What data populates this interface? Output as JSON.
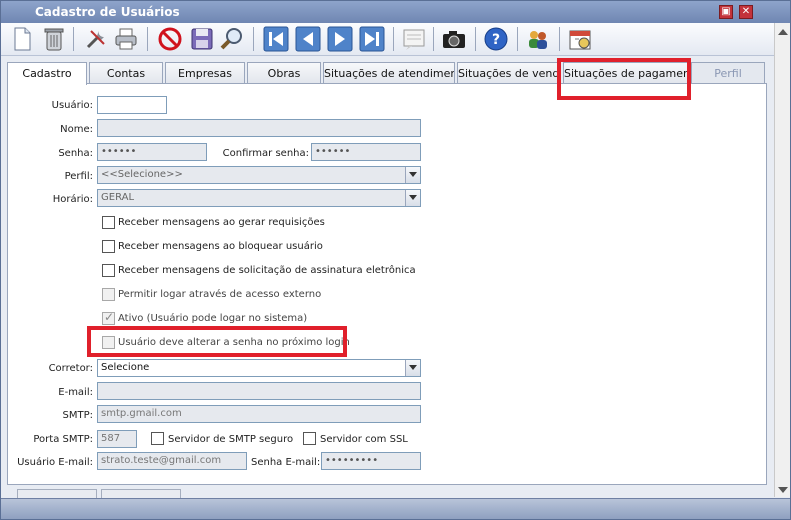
{
  "window": {
    "title": "Cadastro de Usuários",
    "minimize_label": "▣",
    "close_label": "✕"
  },
  "toolbar": {
    "buttons": [
      "new-icon",
      "trash-icon",
      "tools-icon",
      "print-icon",
      "cancel-icon",
      "save-icon",
      "search-icon",
      "first-icon",
      "prev-icon",
      "next-icon",
      "last-icon",
      "notes-icon",
      "camera-icon",
      "help-icon",
      "users-icon",
      "calendar-icon"
    ]
  },
  "tabs": [
    {
      "label": "Cadastro"
    },
    {
      "label": "Contas"
    },
    {
      "label": "Empresas"
    },
    {
      "label": "Obras"
    },
    {
      "label": "Situações de atendimento"
    },
    {
      "label": "Situações de venda"
    },
    {
      "label": "Situações de pagamento"
    },
    {
      "label": "Perfil"
    }
  ],
  "form": {
    "usuario_label": "Usuário:",
    "usuario_value": "",
    "nome_label": "Nome:",
    "nome_value": "",
    "senha_label": "Senha:",
    "senha_value": "••••••",
    "confirmar_label": "Confirmar senha:",
    "confirmar_value": "••••••",
    "perfil_label": "Perfil:",
    "perfil_value": "<<Selecione>>",
    "horario_label": "Horário:",
    "horario_value": "GERAL",
    "chk_requisicoes": "Receber mensagens ao gerar requisições",
    "chk_bloquear": "Receber mensagens ao bloquear usuário",
    "chk_assinatura": "Receber mensagens de solicitação de assinatura eletrônica",
    "chk_externo": "Permitir logar através de acesso externo",
    "chk_ativo": "Ativo (Usuário pode logar no sistema)",
    "chk_alterar_senha": "Usuário deve alterar a senha no próximo login",
    "corretor_label": "Corretor:",
    "corretor_value": "Selecione",
    "email_label": "E-mail:",
    "email_value": "",
    "smtp_label": "SMTP:",
    "smtp_value": "smtp.gmail.com",
    "porta_label": "Porta SMTP:",
    "porta_value": "587",
    "smtp_seguro_label": "Servidor de SMTP seguro",
    "ssl_label": "Servidor com SSL",
    "usuario_email_label": "Usuário E-mail:",
    "usuario_email_value": "strato.teste@gmail.com",
    "senha_email_label": "Senha E-mail:",
    "senha_email_value": "•••••••••"
  },
  "colors": {
    "highlight": "#e0202b",
    "titlebar": "#7b90ba"
  }
}
